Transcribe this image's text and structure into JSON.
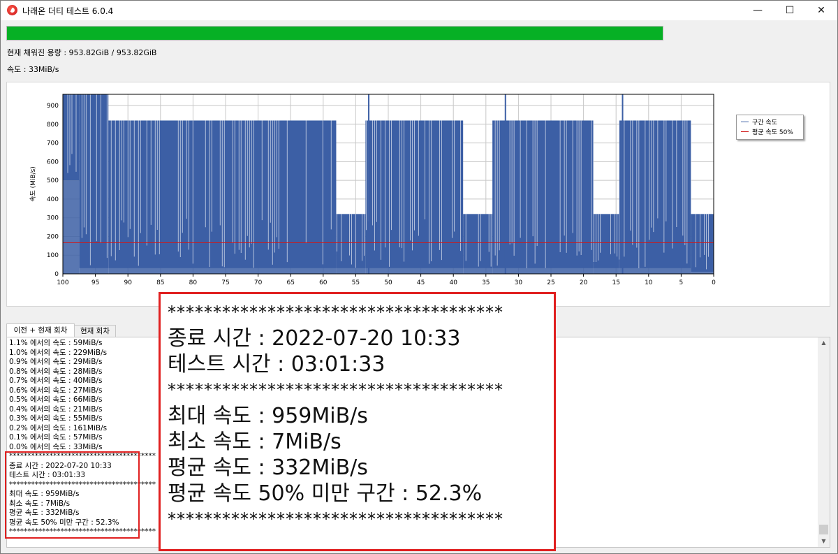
{
  "window": {
    "title": "나래온 더티 테스트 6.0.4",
    "controls": {
      "minimize": "—",
      "maximize": "☐",
      "close": "✕"
    }
  },
  "status": {
    "capacity_text": "현재 채워진 용량 : 953.82GiB / 953.82GiB",
    "speed_text": "속도 : 33MiB/s",
    "progress": 1.0,
    "progress_color": "#06b025"
  },
  "chart_data": {
    "type": "area",
    "title": "",
    "xlabel": "",
    "ylabel": "속도 (MiB/s)",
    "x_direction": "reversed",
    "xlim": [
      100,
      0
    ],
    "ylim": [
      0,
      960
    ],
    "x_ticks": [
      "100",
      "95",
      "90",
      "85",
      "80",
      "75",
      "70",
      "65",
      "60",
      "55",
      "50",
      "45",
      "40",
      "35",
      "30",
      "25",
      "20",
      "15",
      "10",
      "5",
      "0"
    ],
    "y_ticks": [
      "0",
      "100",
      "200",
      "300",
      "400",
      "500",
      "600",
      "700",
      "800",
      "900"
    ],
    "grid": true,
    "legend_position": "right",
    "series": [
      {
        "name": "구간 속도",
        "color": "#3c5fa5",
        "profile": [
          {
            "x_from": 100,
            "x_to": 97.5,
            "low": 500,
            "high": 959
          },
          {
            "x_from": 97.5,
            "x_to": 93,
            "low": 30,
            "high": 959
          },
          {
            "x_from": 93,
            "x_to": 58,
            "low": 30,
            "high": 820
          },
          {
            "x_from": 58,
            "x_to": 53.5,
            "low": 30,
            "high": 320
          },
          {
            "x_from": 53.5,
            "x_to": 38.5,
            "low": 30,
            "high": 820
          },
          {
            "x_from": 38.5,
            "x_to": 34,
            "low": 30,
            "high": 320
          },
          {
            "x_from": 34,
            "x_to": 18.5,
            "low": 30,
            "high": 820
          },
          {
            "x_from": 18.5,
            "x_to": 14.5,
            "low": 30,
            "high": 320
          },
          {
            "x_from": 14.5,
            "x_to": 3.5,
            "low": 30,
            "high": 820
          },
          {
            "x_from": 3.5,
            "x_to": 0,
            "low": 10,
            "high": 320
          }
        ],
        "spikes": [
          {
            "x": 53,
            "y": 959
          },
          {
            "x": 32,
            "y": 959
          },
          {
            "x": 14,
            "y": 959
          }
        ]
      },
      {
        "name": "평균 속도 50%",
        "color": "#d01818",
        "values": [
          166
        ],
        "x": [
          100
        ]
      }
    ]
  },
  "tabs": [
    {
      "label": "이전 + 현재 회차",
      "active": true
    },
    {
      "label": "현재 회차",
      "active": false
    }
  ],
  "log": {
    "lines": [
      "1.1% 에서의 속도 : 59MiB/s",
      "1.0% 에서의 속도 : 229MiB/s",
      "0.9% 에서의 속도 : 29MiB/s",
      "0.8% 에서의 속도 : 28MiB/s",
      "0.7% 에서의 속도 : 40MiB/s",
      "0.6% 에서의 속도 : 27MiB/s",
      "0.5% 에서의 속도 : 66MiB/s",
      "0.4% 에서의 속도 : 21MiB/s",
      "0.3% 에서의 속도 : 55MiB/s",
      "0.2% 에서의 속도 : 161MiB/s",
      "0.1% 에서의 속도 : 57MiB/s",
      "0.0% 에서의 속도 : 33MiB/s",
      "****************************************",
      "종료 시간 : 2022-07-20 10:33",
      "테스트 시간 : 03:01:33",
      "****************************************",
      "최대 속도 : 959MiB/s",
      "최소 속도 : 7MiB/s",
      "평균 속도 : 332MiB/s",
      "평균 속도 50% 미만 구간 : 52.3%",
      "****************************************"
    ]
  },
  "zoom": {
    "separator": "*************************************",
    "end_time": "종료 시간 : 2022-07-20 10:33",
    "test_time": "테스트 시간 : 03:01:33",
    "max_speed": "최대 속도 : 959MiB/s",
    "min_speed": "최소 속도 : 7MiB/s",
    "avg_speed": "평균 속도 : 332MiB/s",
    "below_half": "평균 속도 50% 미만 구간 : 52.3%"
  },
  "scroll": {
    "up": "▲",
    "down": "▼"
  }
}
